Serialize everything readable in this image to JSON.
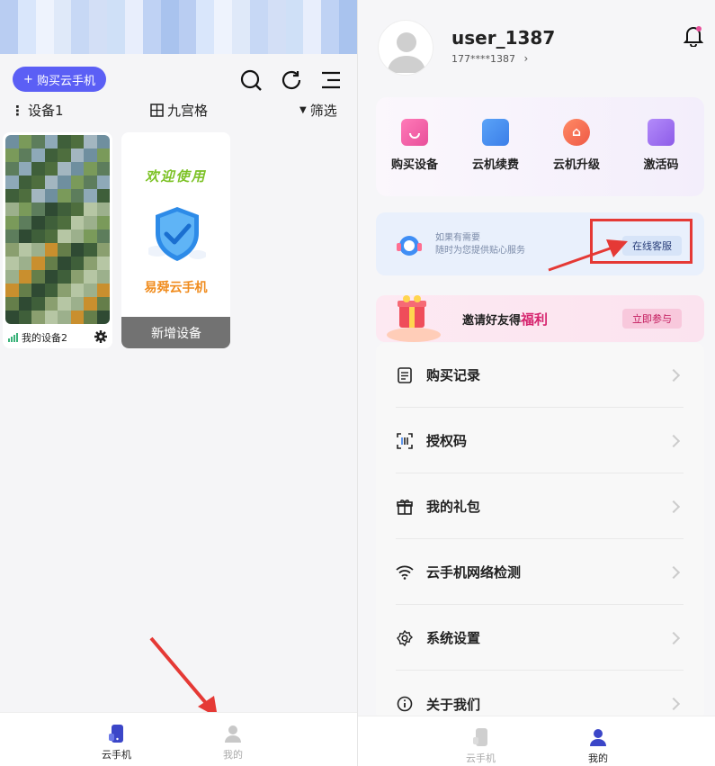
{
  "left": {
    "buy_button": "购买云手机",
    "group_label": "设备1",
    "view_label": "九宫格",
    "filter_label": "筛选",
    "device_card": {
      "name": "我的设备2"
    },
    "new_card": {
      "welcome": "欢迎使用",
      "brand": "易舜云手机",
      "new_device_label": "新增设备"
    },
    "nav": [
      {
        "label": "云手机",
        "icon": "phone-icon",
        "active": true
      },
      {
        "label": "我的",
        "icon": "user-icon",
        "active": false
      }
    ]
  },
  "right": {
    "profile": {
      "username": "user_1387",
      "phone": "177****1387"
    },
    "quick_actions": [
      {
        "label": "购买设备",
        "icon": "shopping-bag-icon",
        "color": "#e84f9a"
      },
      {
        "label": "云机续费",
        "icon": "renew-card-icon",
        "color": "#3b7ee8"
      },
      {
        "label": "云机升级",
        "icon": "upgrade-icon",
        "color": "#ef5a46"
      },
      {
        "label": "激活码",
        "icon": "activation-code-icon",
        "color": "#8d5ce8"
      }
    ],
    "service": {
      "line1": "如果有需要",
      "line2": "随时为您提供贴心服务",
      "button": "在线客服"
    },
    "invite": {
      "text": "邀请好友得",
      "highlight": "福利",
      "button": "立即参与"
    },
    "menu": [
      {
        "label": "购买记录",
        "icon": "document-icon"
      },
      {
        "label": "授权码",
        "icon": "scan-code-icon"
      },
      {
        "label": "我的礼包",
        "icon": "gift-icon"
      },
      {
        "label": "云手机网络检测",
        "icon": "wifi-icon"
      },
      {
        "label": "系统设置",
        "icon": "settings-gear-icon"
      },
      {
        "label": "关于我们",
        "icon": "info-icon"
      }
    ],
    "nav": [
      {
        "label": "云手机",
        "icon": "phone-icon",
        "active": false
      },
      {
        "label": "我的",
        "icon": "user-icon",
        "active": true
      }
    ]
  },
  "colors": {
    "accent": "#5b5ff5",
    "nav_active": "#3b46c8",
    "highlight_box": "#e53935"
  }
}
